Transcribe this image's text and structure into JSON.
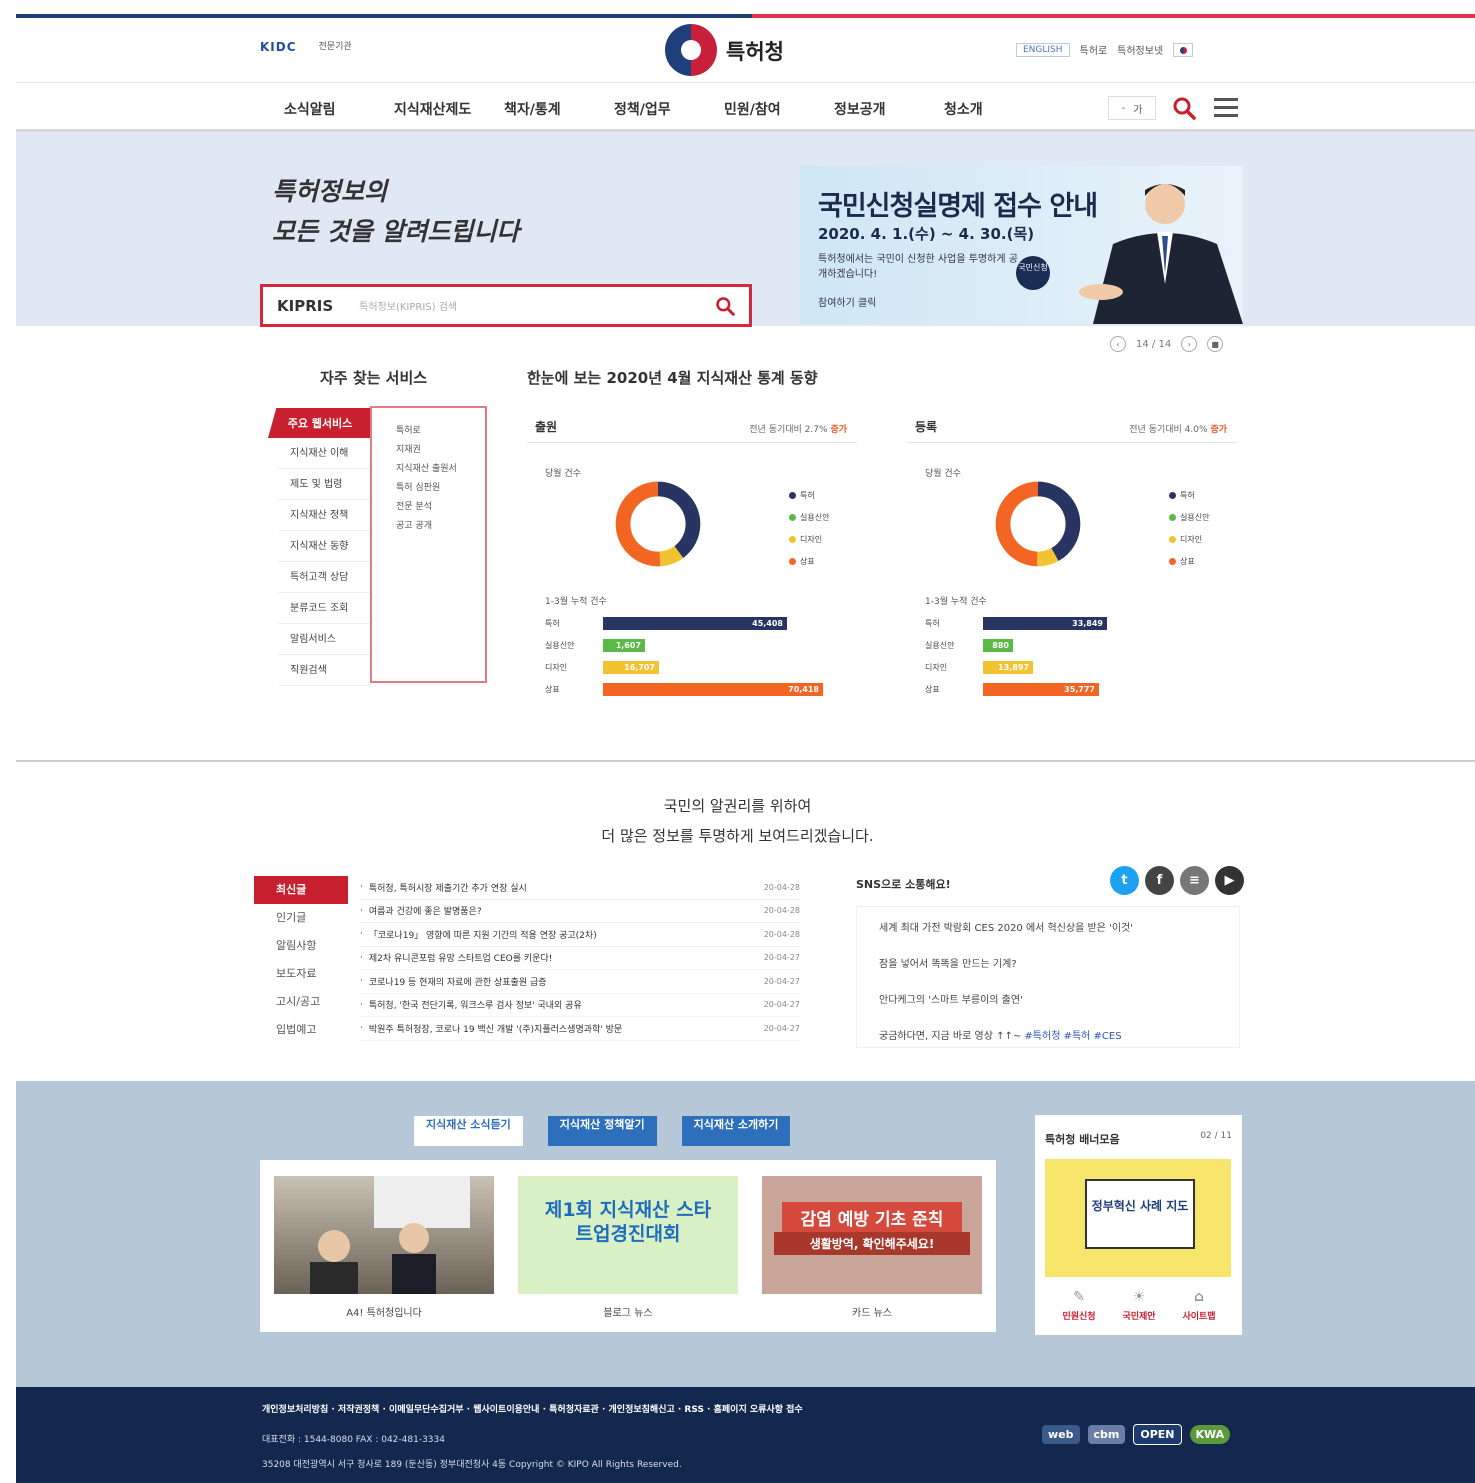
{
  "header": {
    "logo_left": "KIDC",
    "logo_small": "전문기관",
    "org_name": "특허청",
    "util_links": [
      "ENGLISH",
      "특허로",
      "특허정보넷"
    ]
  },
  "nav": {
    "items": [
      "소식알림",
      "지식재산제도",
      "책자/통계",
      "정책/업무",
      "민원/참여",
      "정보공개",
      "청소개"
    ],
    "font_minus": "-",
    "font_plus": "가"
  },
  "hero": {
    "copy_line1": "특허정보의",
    "copy_line2": "모든 것을 알려드립니다",
    "search_label": "KIPRIS",
    "search_placeholder": "특허정보(KIPRIS) 검색",
    "banner_title": "국민신청실명제 접수 안내",
    "banner_date": "2020. 4. 1.(수) ~ 4. 30.(목)",
    "banner_desc": "특허청에서는 국민이 신청한 사업을 투명하게 공개하겠습니다!",
    "banner_link": "참여하기 클릭",
    "banner_badge": "국민신청",
    "pager": "14 / 14"
  },
  "services": {
    "title": "자주 찾는 서비스",
    "active_tab": "주요 웹서비스",
    "list": [
      "지식재산 이해",
      "제도 및 법령",
      "지식재산 정책",
      "지식재산 동향",
      "특허고객 상담",
      "분류코드 조회",
      "알림서비스",
      "직원검색"
    ],
    "sub_items": [
      "특허로",
      "지재권",
      "지식재산 출원서",
      "특허 심판원",
      "전문 분석",
      "공고 공개"
    ]
  },
  "stats": {
    "title": "한눈에 보는 2020년 4월 지식재산 통계 동향",
    "panels": [
      {
        "name": "출원",
        "change_text": "전년 동기대비 2.7%",
        "change_em": "증가",
        "sub_month": "당월 건수",
        "sub_cum": "1-3월 누적 건수",
        "legend": [
          "특허",
          "실용신안",
          "디자인",
          "상표"
        ],
        "bars": [
          {
            "label": "특허",
            "value": "45,408"
          },
          {
            "label": "실용신안",
            "value": "1,607"
          },
          {
            "label": "디자인",
            "value": "16,707"
          },
          {
            "label": "상표",
            "value": "70,418"
          }
        ]
      },
      {
        "name": "등록",
        "change_text": "전년 동기대비 4.0%",
        "change_em": "증가",
        "sub_month": "당월 건수",
        "sub_cum": "1-3월 누적 건수",
        "legend": [
          "특허",
          "실용신안",
          "디자인",
          "상표"
        ],
        "bars": [
          {
            "label": "특허",
            "value": "33,849"
          },
          {
            "label": "실용신안",
            "value": "880"
          },
          {
            "label": "디자인",
            "value": "13,897"
          },
          {
            "label": "상표",
            "value": "35,777"
          }
        ]
      }
    ],
    "colors": {
      "patent": "#283563",
      "utility": "#5bb946",
      "design": "#f1c232",
      "trademark": "#f26522"
    }
  },
  "notice": {
    "tagline1": "국민의 알권리를 위하여",
    "tagline2": "더 많은 정보를 투명하게 보여드리겠습니다.",
    "tabs": [
      "최신글",
      "인기글",
      "알림사항",
      "보도자료",
      "고시/공고",
      "입법예고"
    ],
    "posts": [
      {
        "title": "특허청, 특허시장 제출기간 추가 연장 실시",
        "date": "20-04-28"
      },
      {
        "title": "여름과 건강에 좋은 발명품은?",
        "date": "20-04-28"
      },
      {
        "title": "「코로나19」 영향에 따른 지원 기간의 적용 연장 공고(2차)",
        "date": "20-04-28"
      },
      {
        "title": "제2차 유니콘포럼 유망 스타트업 CEO를 키운다!",
        "date": "20-04-27"
      },
      {
        "title": "코로나19 등 현재의 자료에 관한 상표출원 급증",
        "date": "20-04-27"
      },
      {
        "title": "특허청, '한국 전단기록, 워크스루 검사 정보' 국내외 공유",
        "date": "20-04-27"
      },
      {
        "title": "박원주 특허청장, 코로나 19 백신 개발 '(주)지플러스생명과학' 방문",
        "date": "20-04-27"
      }
    ],
    "sns_title": "SNS으로 소통해요!",
    "sns_posts": [
      "세계 최대 가전 박람회 CES 2020 에서 혁신상을 받은 '이것'",
      "잠을 넣어서 똑똑을 만드는 기계?",
      "안다케그의 '스마트 부릉이의 출연'",
      "궁금하다면, 지금 바로 영상 ↑↑~"
    ],
    "sns_hashtags": "#특허청 #특허 #CES"
  },
  "promo": {
    "tabs": [
      "지식재산 소식듣기",
      "지식재산 정책알기",
      "지식재산 소개하기"
    ],
    "cards": [
      {
        "caption": "A4! 특허청입니다"
      },
      {
        "caption": "블로그 뉴스"
      },
      {
        "caption": "카드 뉴스"
      }
    ],
    "card2_text": "제1회 지식재산 스타트업경진대회",
    "card3_text": "감염 예방 기초 준칙",
    "card3_sub": "생활방역, 확인해주세요!",
    "banner_title": "특허청 배너모음",
    "banner_pager": "02 / 11",
    "banner_img_text": "정부혁신 사례 지도",
    "quick": [
      "민원신청",
      "국민제안",
      "사이트맵"
    ]
  },
  "footer": {
    "links": "개인정보처리방침 · 저작권정책 · 이메일무단수집거부 · 웹사이트이용안내 · 특허청자료관 · 개인정보침해신고 · RSS · 홈페이지 오류사항 접수",
    "contact": "대표전화 : 1544-8080   FAX : 042-481-3334",
    "address": "35208 대전광역시 서구 청사로 189 (둔산동) 정부대전청사 4동   Copyright © KIPO All Rights Reserved.",
    "marks": [
      "web",
      "cbm",
      "OPEN",
      "KWA"
    ]
  }
}
